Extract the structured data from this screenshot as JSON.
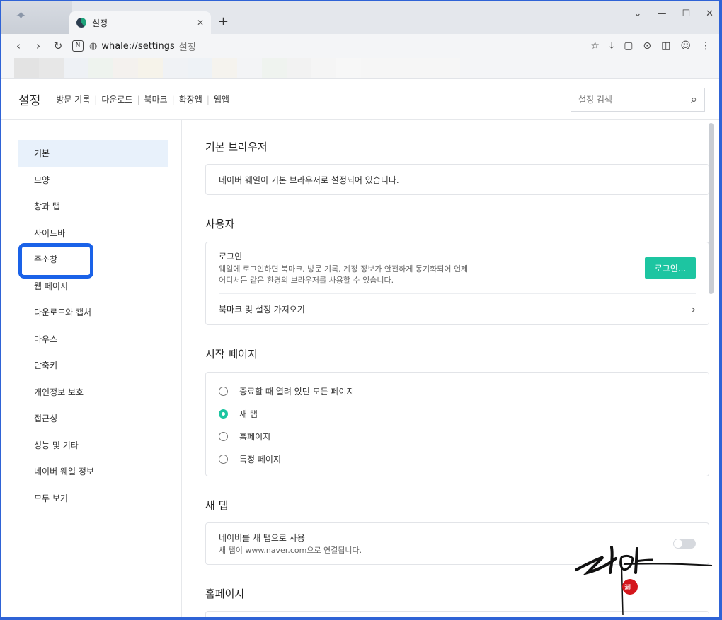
{
  "tab": {
    "title": "설정",
    "close": "✕",
    "new_tab": "+"
  },
  "window_controls": [
    "⌄",
    "—",
    "☐",
    "✕"
  ],
  "address": {
    "url": "whale://settings",
    "suffix": "설정"
  },
  "nav": {
    "back": "‹",
    "forward": "›",
    "reload": "↻",
    "naver": "N"
  },
  "toolbar_icons": [
    "☆",
    "⤓",
    "▢",
    "⊙",
    "◫",
    "☺",
    "⋮"
  ],
  "header": {
    "title": "설정",
    "nav": [
      "방문 기록",
      "다운로드",
      "북마크",
      "확장앱",
      "웹앱"
    ],
    "search_placeholder": "설정 검색",
    "search_icon": "⌕"
  },
  "sidebar": {
    "items": [
      "기본",
      "모양",
      "창과 탭",
      "사이드바",
      "주소창",
      "웹 페이지",
      "다운로드와 캡처",
      "마우스",
      "단축키",
      "개인정보 보호",
      "접근성",
      "성능 및 기타",
      "네이버 웨일 정보",
      "모두 보기"
    ]
  },
  "sections": {
    "default_browser": {
      "title": "기본 브라우저",
      "text": "네이버 웨일이 기본 브라우저로 설정되어 있습니다."
    },
    "user": {
      "title": "사용자",
      "login_label": "로그인",
      "login_desc1": "웨일에 로그인하면 북마크, 방문 기록, 계정 정보가 안전하게 동기화되어 언제",
      "login_desc2": "어디서든 같은 환경의 브라우저를 사용할 수 있습니다.",
      "login_button": "로그인...",
      "import_label": "북마크 및 설정 가져오기",
      "import_chevron": "›"
    },
    "startup": {
      "title": "시작 페이지",
      "options": [
        "종료할 때 열려 있던 모든 페이지",
        "새 탭",
        "홈페이지",
        "특정 페이지"
      ],
      "selected": "새 탭"
    },
    "new_tab": {
      "title": "새 탭",
      "label": "네이버를 새 탭으로 사용",
      "desc": "새 탭이 www.naver.com으로 연결됩니다.",
      "enabled": false
    },
    "homepage": {
      "title": "홈페이지"
    }
  },
  "colors": {
    "accent": "#1dc5a1",
    "highlight": "#1a62e8",
    "active_bg": "#e8f1fb"
  }
}
